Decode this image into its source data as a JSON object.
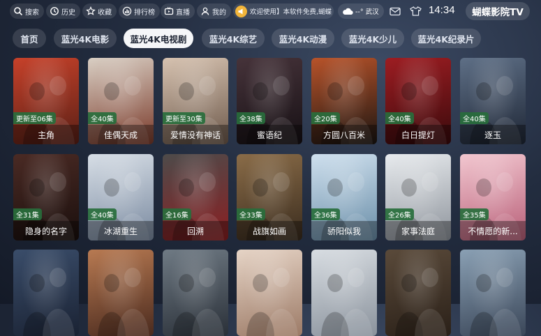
{
  "topbar": {
    "buttons": [
      {
        "label": "搜索",
        "icon": "search-icon"
      },
      {
        "label": "历史",
        "icon": "history-icon"
      },
      {
        "label": "收藏",
        "icon": "star-icon"
      },
      {
        "label": "排行榜",
        "icon": "ranking-icon"
      },
      {
        "label": "直播",
        "icon": "tv-icon"
      },
      {
        "label": "我的",
        "icon": "user-icon"
      }
    ],
    "notice": "欢迎使用】本软件免费,蝴蝶",
    "weather": "--°  武汉",
    "time": "14:34",
    "brand": "蝴蝶影院TV"
  },
  "nav": {
    "tabs": [
      "首页",
      "蓝光4K电影",
      "蓝光4K电视剧",
      "蓝光4K综艺",
      "蓝光4K动漫",
      "蓝光4K少儿",
      "蓝光4K纪录片"
    ],
    "active_index": 2
  },
  "grid": {
    "rows": [
      [
        {
          "title": "主角",
          "badge": "更新至06集",
          "color1": "#c6412a",
          "color2": "#5a2016"
        },
        {
          "title": "佳偶天成",
          "badge": "全40集",
          "color1": "#d9cfc4",
          "color2": "#7a3a2a"
        },
        {
          "title": "爱情没有神话",
          "badge": "更新至30集",
          "color1": "#d6c2b0",
          "color2": "#6e5a4c"
        },
        {
          "title": "蜜语纪",
          "badge": "全38集",
          "color1": "#46333a",
          "color2": "#161014"
        },
        {
          "title": "方圆八百米",
          "badge": "全20集",
          "color1": "#b8532a",
          "color2": "#1c1612"
        },
        {
          "title": "白日提灯",
          "badge": "全40集",
          "color1": "#9d1d22",
          "color2": "#3a0a0c"
        },
        {
          "title": "逐玉",
          "badge": "全40集",
          "color1": "#5e6f86",
          "color2": "#1f2736"
        }
      ],
      [
        {
          "title": "隐身的名字",
          "badge": "全31集",
          "color1": "#4a2a24",
          "color2": "#1a0f0d"
        },
        {
          "title": "冰湖重生",
          "badge": "全40集",
          "color1": "#d7dee6",
          "color2": "#7a8aa0"
        },
        {
          "title": "回溯",
          "badge": "全16集",
          "color1": "#4d4b4a",
          "color2": "#8b1f22"
        },
        {
          "title": "战旗如画",
          "badge": "全33集",
          "color1": "#8a6c48",
          "color2": "#3a2c1e"
        },
        {
          "title": "骄阳似我",
          "badge": "全36集",
          "color1": "#cfe0ee",
          "color2": "#6a8ea8"
        },
        {
          "title": "家事法庭",
          "badge": "全26集",
          "color1": "#e8ebee",
          "color2": "#8e949c"
        },
        {
          "title": "不情愿的新...",
          "badge": "全35集",
          "color1": "#f2c7d0",
          "color2": "#b85f78"
        }
      ],
      [
        {
          "title": "",
          "badge": "",
          "color1": "#3a4d6a",
          "color2": "#1a2233"
        },
        {
          "title": "",
          "badge": "",
          "color1": "#b87a52",
          "color2": "#4a2a1e"
        },
        {
          "title": "",
          "badge": "",
          "color1": "#6f7a84",
          "color2": "#2a3038"
        },
        {
          "title": "",
          "badge": "",
          "color1": "#e6d4c6",
          "color2": "#9c7a66"
        },
        {
          "title": "",
          "badge": "",
          "color1": "#d8dde2",
          "color2": "#8a929c"
        },
        {
          "title": "",
          "badge": "",
          "color1": "#5a4a3a",
          "color2": "#2a2018"
        },
        {
          "title": "",
          "badge": "",
          "color1": "#8aa0b4",
          "color2": "#3a4658"
        }
      ]
    ]
  }
}
